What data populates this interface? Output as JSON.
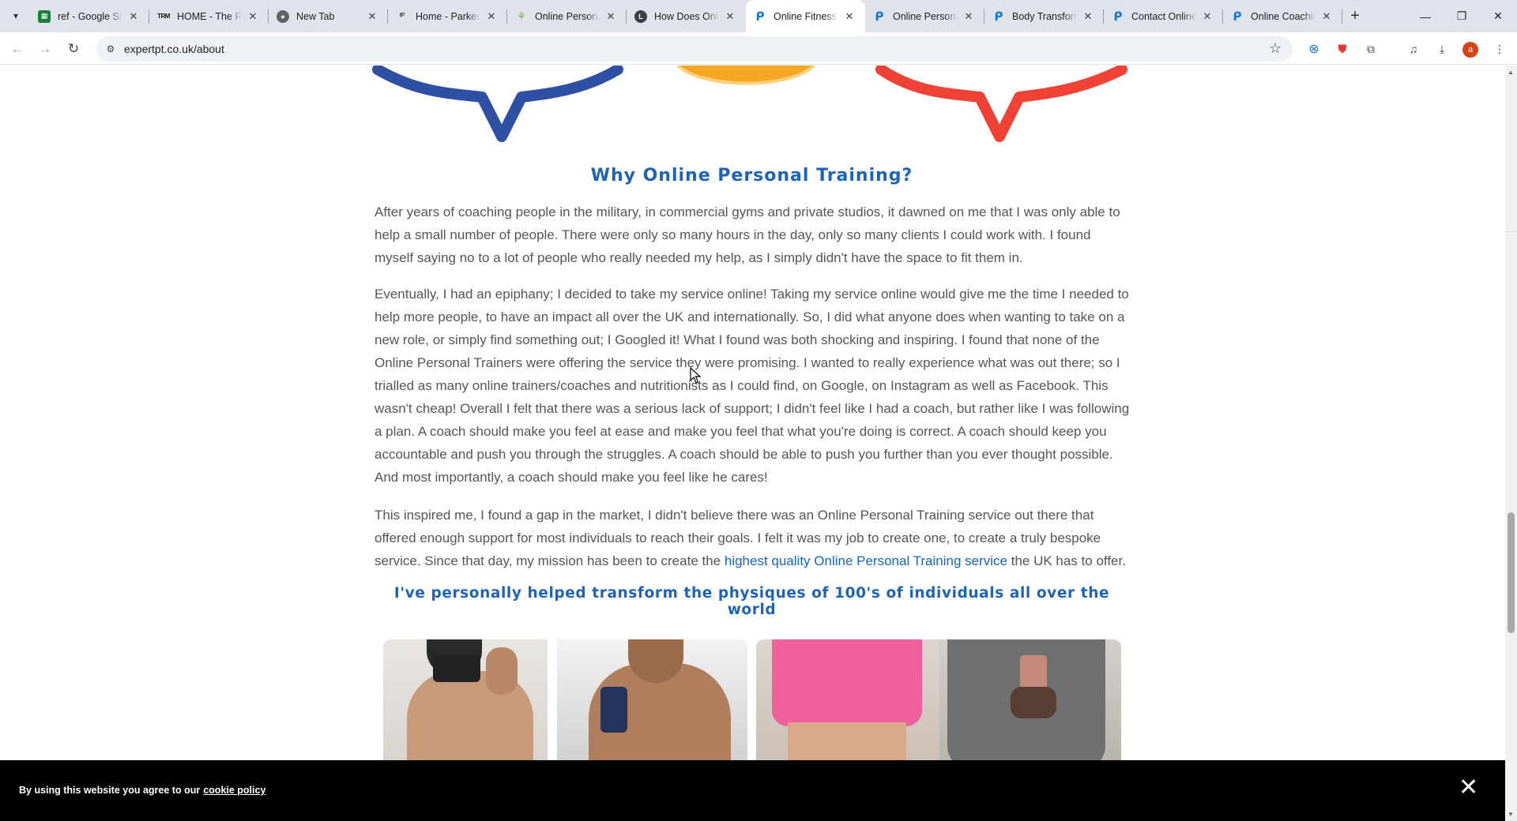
{
  "browser": {
    "tabs": [
      {
        "title": "ref - Google Sh",
        "favicon": "sheets-icon"
      },
      {
        "title": "HOME - The Ru",
        "favicon": "trm-icon"
      },
      {
        "title": "New Tab",
        "favicon": "chrome-icon"
      },
      {
        "title": "Home - Parker",
        "favicon": "parker-icon"
      },
      {
        "title": "Online Persona",
        "favicon": "leaf-icon"
      },
      {
        "title": "How Does Onli",
        "favicon": "l-icon"
      },
      {
        "title": "Online Fitness",
        "favicon": "expertpt-icon",
        "active": true
      },
      {
        "title": "Online Persona",
        "favicon": "expertpt-icon"
      },
      {
        "title": "Body Transform",
        "favicon": "expertpt-icon"
      },
      {
        "title": "Contact Online",
        "favicon": "expertpt-icon"
      },
      {
        "title": "Online Coachin",
        "favicon": "expertpt-icon"
      }
    ],
    "url": "expertpt.co.uk/about",
    "profile_initial": "a"
  },
  "page": {
    "heading": "Why Online Personal Training?",
    "paragraph1": "After years of coaching people in the military, in commercial gyms and private studios, it dawned on me that I was only able to help a small number of people. There were only so many hours in the day, only so many clients I could work with. I found myself saying no to a lot of people who really needed my help, as I simply didn't have the space to fit them in.",
    "paragraph2": "Eventually, I had an epiphany; I decided to take my service online! Taking my service online would give me the time I needed to help more people, to have an impact all over the UK and internationally. So, I did what anyone does when wanting to take on a new role, or simply find something out; I Googled it! What I found was both shocking and inspiring. I found that none of the Online Personal Trainers were offering the service they were promising. I wanted to really experience what was out there; so I trialled as many online trainers/coaches and nutritionists as I could find, on Google, on Instagram as well as Facebook. This wasn't cheap! Overall I felt that there was a serious lack of support; I didn't feel like I had a coach, but rather like I was following a plan. A coach should make you feel at ease and make you feel that what you're doing is correct. A coach should keep you accountable and push you through the struggles. A coach should be able to push you further than you ever thought possible. And most importantly, a coach should make you feel like he cares!",
    "paragraph3_before": "This inspired me, I found a gap in the market, I didn't believe there was an Online Personal Training service out there that offered enough support for most individuals to reach their goals. I felt it was my job to create one, to create a truly bespoke service. Since that day, my mission has been to create the ",
    "paragraph3_link": "highest quality Online Personal Training service",
    "paragraph3_after": " the UK has to offer.",
    "tagline": "I've personally helped transform the physiques of 100's of individuals all over the world"
  },
  "cookie_bar": {
    "text": "By using this website you agree to our",
    "link": "cookie policy",
    "close": "✕"
  },
  "colors": {
    "accent_blue": "#1e63b8",
    "body_text": "#555555",
    "deco_blue": "#2f4fa3",
    "deco_orange": "#f5a623",
    "deco_red": "#ef4136"
  }
}
